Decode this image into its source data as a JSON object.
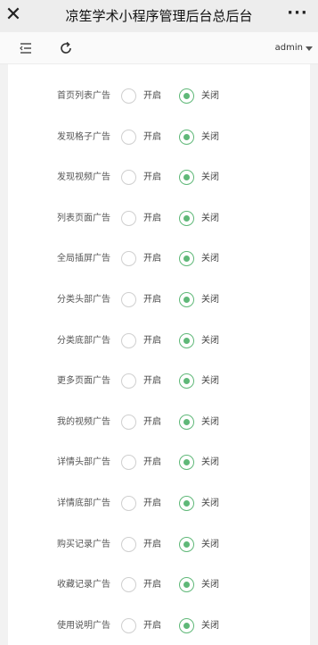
{
  "titlebar": {
    "close_glyph": "✕",
    "title": "凉笙学术小程序管理后台总后台",
    "more_glyph": "···"
  },
  "toolbar": {
    "menu_icon": "menu-fold-icon",
    "refresh_icon": "refresh-icon",
    "user": "admin"
  },
  "accent_color": "#5fb878",
  "options": {
    "on": "开启",
    "off": "关闭"
  },
  "settings": [
    {
      "label": "首页列表广告",
      "selected": "off"
    },
    {
      "label": "发现格子广告",
      "selected": "off"
    },
    {
      "label": "发现视频广告",
      "selected": "off"
    },
    {
      "label": "列表页面广告",
      "selected": "off"
    },
    {
      "label": "全局插屏广告",
      "selected": "off"
    },
    {
      "label": "分类头部广告",
      "selected": "off"
    },
    {
      "label": "分类底部广告",
      "selected": "off"
    },
    {
      "label": "更多页面广告",
      "selected": "off"
    },
    {
      "label": "我的视频广告",
      "selected": "off"
    },
    {
      "label": "详情头部广告",
      "selected": "off"
    },
    {
      "label": "详情底部广告",
      "selected": "off"
    },
    {
      "label": "购买记录广告",
      "selected": "off"
    },
    {
      "label": "收藏记录广告",
      "selected": "off"
    },
    {
      "label": "使用说明广告",
      "selected": "off"
    }
  ]
}
